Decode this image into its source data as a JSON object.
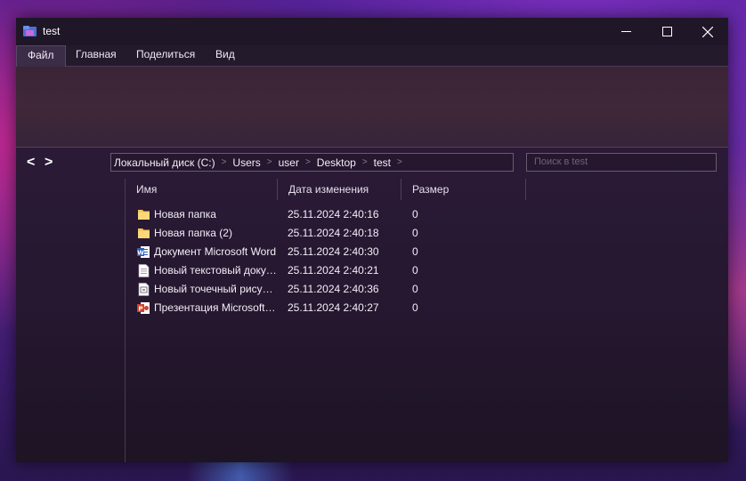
{
  "window": {
    "title": "test"
  },
  "menu": {
    "tabs": [
      "Файл",
      "Главная",
      "Поделиться",
      "Вид"
    ]
  },
  "nav": {
    "back": "<",
    "forward": ">"
  },
  "breadcrumb": [
    "Локальный диск (C:)",
    "Users",
    "user",
    "Desktop",
    "test"
  ],
  "search": {
    "placeholder": "Поиск в test"
  },
  "columns": {
    "name": "Имя",
    "date": "Дата изменения",
    "size": "Размер"
  },
  "files": [
    {
      "name": "Новая папка",
      "date": "25.11.2024 2:40:16",
      "size": "0",
      "icon": "folder-icon"
    },
    {
      "name": "Новая папка (2)",
      "date": "25.11.2024 2:40:18",
      "size": "0",
      "icon": "folder-icon"
    },
    {
      "name": "Документ Microsoft Word",
      "date": "25.11.2024 2:40:30",
      "size": "0",
      "icon": "word-document-icon"
    },
    {
      "name": "Новый текстовый документ",
      "date": "25.11.2024 2:40:21",
      "size": "0",
      "icon": "text-document-icon"
    },
    {
      "name": "Новый точечный рисунок",
      "date": "25.11.2024 2:40:36",
      "size": "0",
      "icon": "bitmap-image-icon"
    },
    {
      "name": "Презентация Microsoft PowerPoint",
      "date": "25.11.2024 2:40:27",
      "size": "0",
      "icon": "powerpoint-document-icon"
    }
  ],
  "colors": {
    "folder": "#f5c85a",
    "word": "#2b5eb8",
    "powerpoint": "#d0452b",
    "accent": "#7a2fbf"
  }
}
